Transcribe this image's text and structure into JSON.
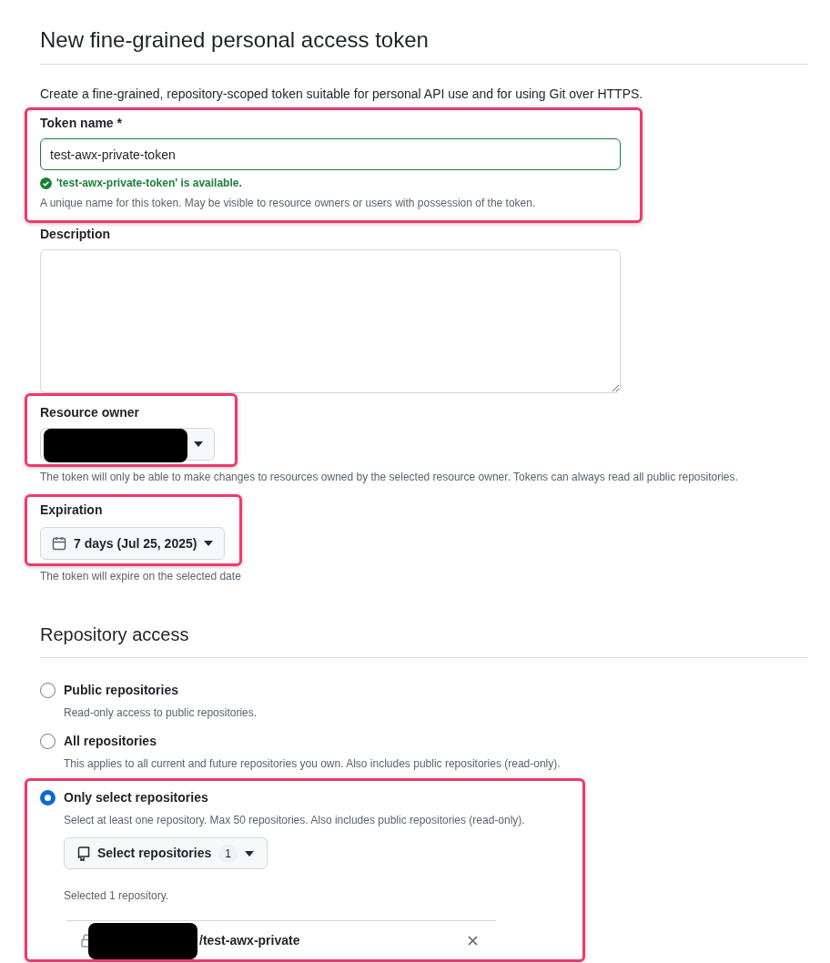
{
  "page_title": "New fine-grained personal access token",
  "intro": "Create a fine-grained, repository-scoped token suitable for personal API use and for using Git over HTTPS.",
  "token_name": {
    "label": "Token name *",
    "value": "test-awx-private-token",
    "validation": "'test-awx-private-token' is available.",
    "valid": true,
    "hint": "A unique name for this token. May be visible to resource owners or users with possession of the token.",
    "highlighted": true
  },
  "description": {
    "label": "Description"
  },
  "resource_owner": {
    "label": "Resource owner",
    "redacted": true,
    "hint": "The token will only be able to make changes to resources owned by the selected resource owner. Tokens can always read all public repositories.",
    "highlighted": true
  },
  "expiration": {
    "label": "Expiration",
    "value": "7 days (Jul 25, 2025)",
    "hint": "The token will expire on the selected date",
    "highlighted": true
  },
  "repository_access": {
    "heading": "Repository access",
    "options": [
      {
        "label": "Public repositories",
        "description": "Read-only access to public repositories.",
        "selected": false,
        "highlighted": false
      },
      {
        "label": "All repositories",
        "description": "This applies to all current and future repositories you own. Also includes public repositories (read-only).",
        "selected": false,
        "highlighted": false
      },
      {
        "label": "Only select repositories",
        "description": "Select at least one repository. Max 50 repositories. Also includes public repositories (read-only).",
        "selected": true,
        "highlighted": true,
        "picker": {
          "label": "Select repositories",
          "count": "1",
          "summary": "Selected 1 repository.",
          "repos": [
            {
              "name": "/test-awx-private",
              "redacted": true
            }
          ]
        }
      }
    ]
  }
}
